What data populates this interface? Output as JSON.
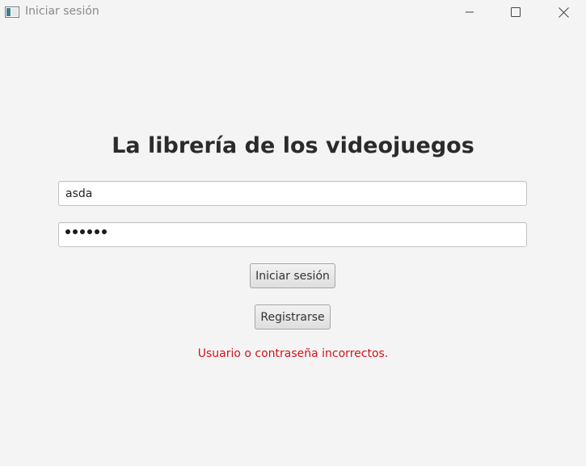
{
  "window": {
    "title": "Iniciar sesión",
    "icon": "app-window-icon",
    "controls": {
      "minimize_icon": "minimize-icon",
      "maximize_icon": "maximize-icon",
      "close_icon": "close-icon"
    }
  },
  "form": {
    "heading": "La librería de los videojuegos",
    "username_value": "asda",
    "password_length": 6,
    "login_label": "Iniciar sesión",
    "register_label": "Registrarse",
    "error_message": "Usuario o contraseña incorrectos."
  },
  "colors": {
    "background": "#f4f4f4",
    "error": "#d4131b",
    "heading": "#2b2b2b"
  }
}
